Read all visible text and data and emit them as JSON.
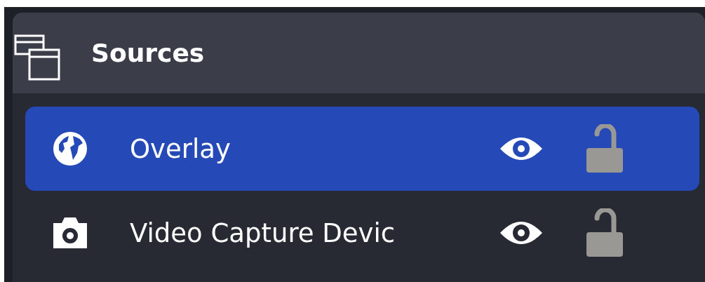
{
  "panel": {
    "title": "Sources"
  },
  "sources": [
    {
      "kind": "browser",
      "name": "Overlay",
      "selected": true,
      "visible": true,
      "locked": false
    },
    {
      "kind": "camera",
      "name": "Video Capture Devic",
      "selected": false,
      "visible": true,
      "locked": false
    }
  ]
}
